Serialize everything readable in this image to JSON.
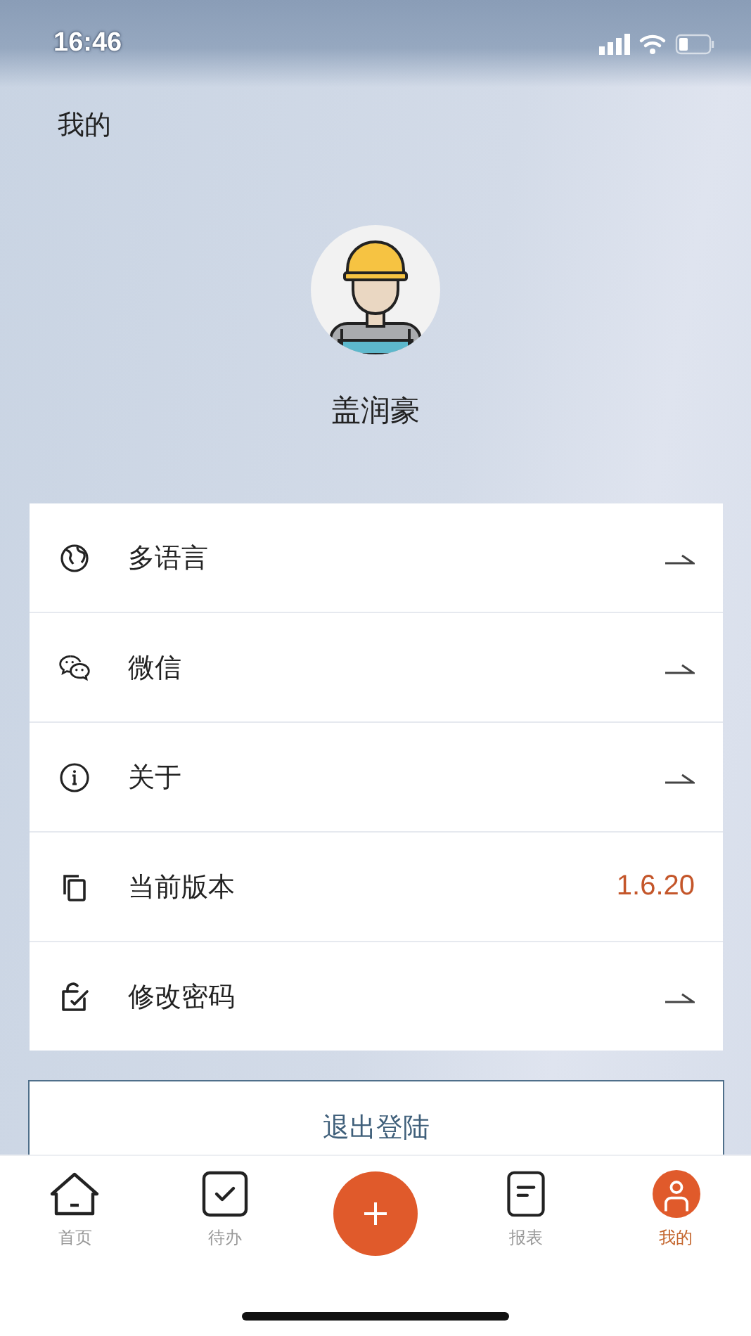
{
  "status_bar": {
    "time": "16:46"
  },
  "header": {
    "title": "我的"
  },
  "profile": {
    "name": "盖润豪"
  },
  "menu": [
    {
      "label": "多语言",
      "kind": "link"
    },
    {
      "label": "微信",
      "kind": "link"
    },
    {
      "label": "关于",
      "kind": "link"
    },
    {
      "label": "当前版本",
      "kind": "value",
      "value": "1.6.20"
    },
    {
      "label": "修改密码",
      "kind": "link"
    }
  ],
  "logout_button": {
    "label": "退出登陆"
  },
  "tab_bar": [
    {
      "kind": "home",
      "label": "首页",
      "selected": false
    },
    {
      "kind": "todo",
      "label": "待办",
      "selected": false
    },
    {
      "kind": "add"
    },
    {
      "kind": "report",
      "label": "报表",
      "selected": false
    },
    {
      "kind": "profile",
      "label": "我的",
      "selected": true
    }
  ]
}
